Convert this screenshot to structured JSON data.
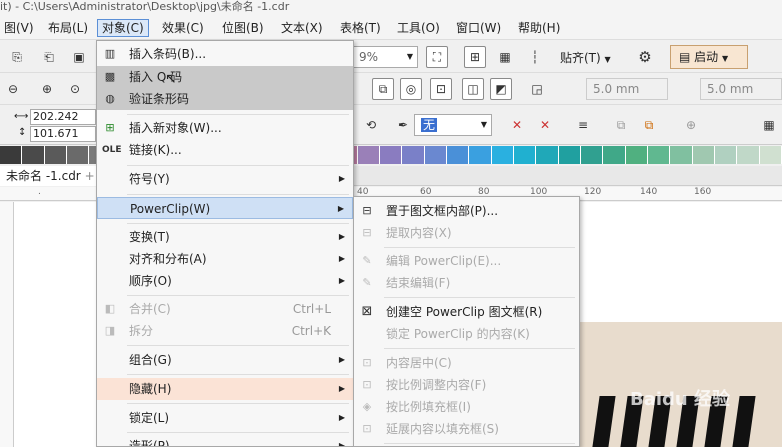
{
  "title_bar": {
    "text": "it) - C:\\Users\\Administrator\\Desktop\\jpg\\未命名 -1.cdr"
  },
  "menubar": {
    "items": [
      "图(V)",
      "布局(L)",
      "对象(C)",
      "效果(C)",
      "位图(B)",
      "文本(X)",
      "表格(T)",
      "工具(O)",
      "窗口(W)",
      "帮助(H)"
    ],
    "active": "对象(C)"
  },
  "toolbar": {
    "zoom_value": "9%",
    "snap_label": "贴齐(T)",
    "launch_label": "启动",
    "offset1": "5.0 mm",
    "offset2": "5.0 mm",
    "width_value": "202.242 mm",
    "height_value": "101.671 mm",
    "fill_value": "无"
  },
  "colors": {
    "accent": "#5b8fd6",
    "menu_hover_gray": "#c9c9c9",
    "menu_hover_blue": "#cfe0f5",
    "menu_hover_peach": "#fbe3d6",
    "palette": [
      "#3a3a3a",
      "#4a4a4a",
      "#5a5a5a",
      "#6a6a6a",
      "#7a7a7a",
      "#8a8a8a",
      "#9a9a9a",
      "#aaaaaa",
      "#bababa",
      "#cacaca",
      "#dadada",
      "#e8e8e8",
      "#f5f5f5",
      "#ffffff",
      "#c98a7a",
      "#b87ca0",
      "#9a80b8",
      "#8a7cc0",
      "#7a80c8",
      "#6a88d0",
      "#4a90d8",
      "#3aa0e0",
      "#2ab0e0",
      "#20b0d0",
      "#20a8b8",
      "#20a0a0",
      "#30a090",
      "#40a888",
      "#50b080",
      "#60b890",
      "#80c0a0",
      "#a0c8b0",
      "#b0d0c0",
      "#c0d8c8",
      "#d0e0d0"
    ]
  },
  "doc_tab": {
    "label": "未命名 -1.cdr"
  },
  "ruler": {
    "ticks": [
      "40",
      "60",
      "80",
      "100",
      "120",
      "140",
      "160"
    ]
  },
  "object_menu": {
    "items": [
      {
        "label": "插入条码(B)...",
        "icon": "barcode-icon"
      },
      {
        "label": "插入 Q  码",
        "icon": "qr-icon",
        "state": "hover"
      },
      {
        "label": "验证条形码",
        "icon": "verify-barcode-icon",
        "state": "hover"
      },
      {
        "label": "插入新对象(W)...",
        "icon": "insert-object-icon"
      },
      {
        "label": "链接(K)...",
        "icon": "ole-icon"
      },
      {
        "label": "符号(Y)",
        "submenu": true
      },
      {
        "label": "PowerClip(W)",
        "submenu": true,
        "state": "open"
      },
      {
        "label": "变换(T)",
        "submenu": true
      },
      {
        "label": "对齐和分布(A)",
        "submenu": true
      },
      {
        "label": "顺序(O)",
        "submenu": true
      },
      {
        "label": "合并(C)",
        "shortcut": "Ctrl+L",
        "disabled": true,
        "icon": "combine-icon"
      },
      {
        "label": "拆分",
        "shortcut": "Ctrl+K",
        "disabled": true,
        "icon": "break-apart-icon"
      },
      {
        "label": "组合(G)",
        "submenu": true
      },
      {
        "label": "隐藏(H)",
        "submenu": true,
        "state": "highlight"
      },
      {
        "label": "锁定(L)",
        "submenu": true
      },
      {
        "label": "造形(P)",
        "submenu": true
      }
    ]
  },
  "powerclip_menu": {
    "items": [
      {
        "label": "置于图文框内部(P)...",
        "icon": "place-inside-frame-icon"
      },
      {
        "label": "提取内容(X)",
        "disabled": true,
        "icon": "extract-content-icon"
      },
      {
        "label": "编辑 PowerClip(E)...",
        "disabled": true,
        "icon": "edit-powerclip-icon"
      },
      {
        "label": "结束编辑(F)",
        "disabled": true,
        "icon": "finish-editing-icon"
      },
      {
        "label": "创建空 PowerClip 图文框(R)",
        "icon": "create-empty-frame-icon"
      },
      {
        "label": "锁定 PowerClip 的内容(K)",
        "disabled": true
      },
      {
        "label": "内容居中(C)",
        "disabled": true,
        "icon": "center-content-icon"
      },
      {
        "label": "按比例调整内容(F)",
        "disabled": true,
        "icon": "fit-content-icon"
      },
      {
        "label": "按比例填充框(I)",
        "disabled": true,
        "icon": "fill-frame-icon"
      },
      {
        "label": "延展内容以填充框(S)",
        "disabled": true,
        "icon": "stretch-content-icon"
      }
    ]
  },
  "watermark": {
    "text": "Baidu 经验"
  }
}
